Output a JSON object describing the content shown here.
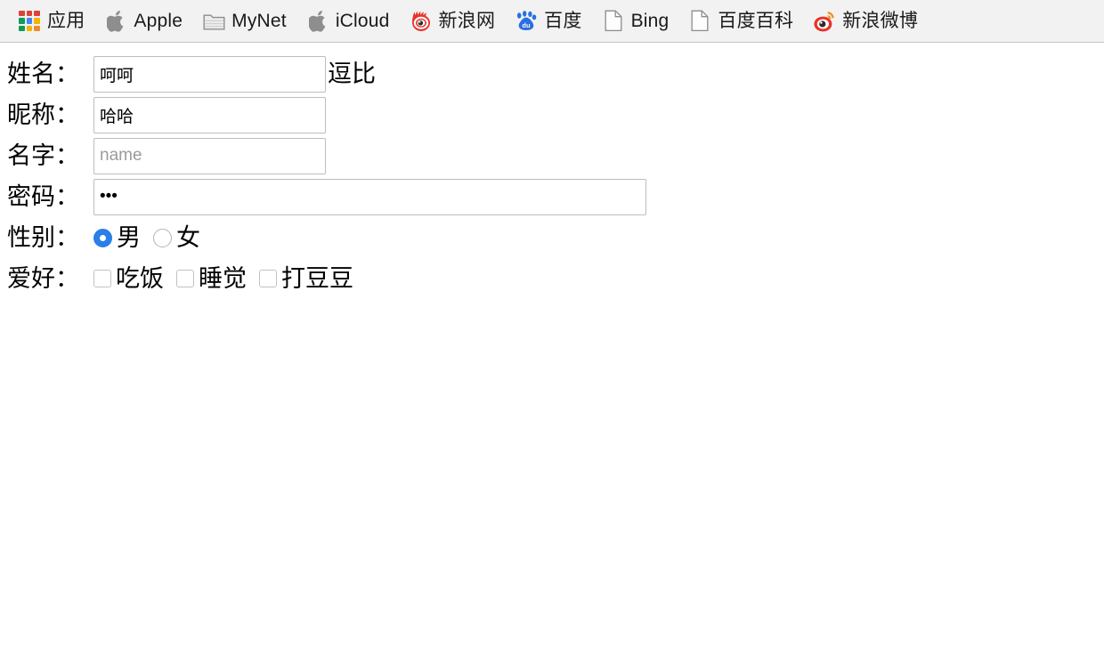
{
  "bookmarks_bar": {
    "items": [
      {
        "label": "应用",
        "icon": "apps-grid-icon"
      },
      {
        "label": "Apple",
        "icon": "apple-logo-icon"
      },
      {
        "label": "MyNet",
        "icon": "folder-icon"
      },
      {
        "label": "iCloud",
        "icon": "apple-logo-icon"
      },
      {
        "label": "新浪网",
        "icon": "sina-eye-icon"
      },
      {
        "label": "百度",
        "icon": "baidu-paw-icon"
      },
      {
        "label": "Bing",
        "icon": "page-icon"
      },
      {
        "label": "百度百科",
        "icon": "page-icon"
      },
      {
        "label": "新浪微博",
        "icon": "weibo-eye-icon"
      }
    ]
  },
  "form": {
    "rows": [
      {
        "label": "姓名：",
        "type": "text",
        "value": "呵呵",
        "placeholder": "",
        "after_text": "逗比"
      },
      {
        "label": "昵称：",
        "type": "text",
        "value": "哈哈",
        "placeholder": ""
      },
      {
        "label": "名字：",
        "type": "text",
        "value": "",
        "placeholder": "name"
      },
      {
        "label": "密码：",
        "type": "password",
        "value": "•••",
        "placeholder": ""
      }
    ],
    "gender": {
      "label": "性别：",
      "options": [
        {
          "label": "男",
          "checked": true
        },
        {
          "label": "女",
          "checked": false
        }
      ]
    },
    "hobby": {
      "label": "爱好：",
      "options": [
        {
          "label": "吃饭",
          "checked": false
        },
        {
          "label": "睡觉",
          "checked": false
        },
        {
          "label": "打豆豆",
          "checked": false
        }
      ]
    }
  },
  "colors": {
    "radio_accent": "#2b7fe8",
    "bar_background": "#f2f2f2",
    "input_border": "#bdbdbd",
    "placeholder": "#9b9b9b"
  }
}
